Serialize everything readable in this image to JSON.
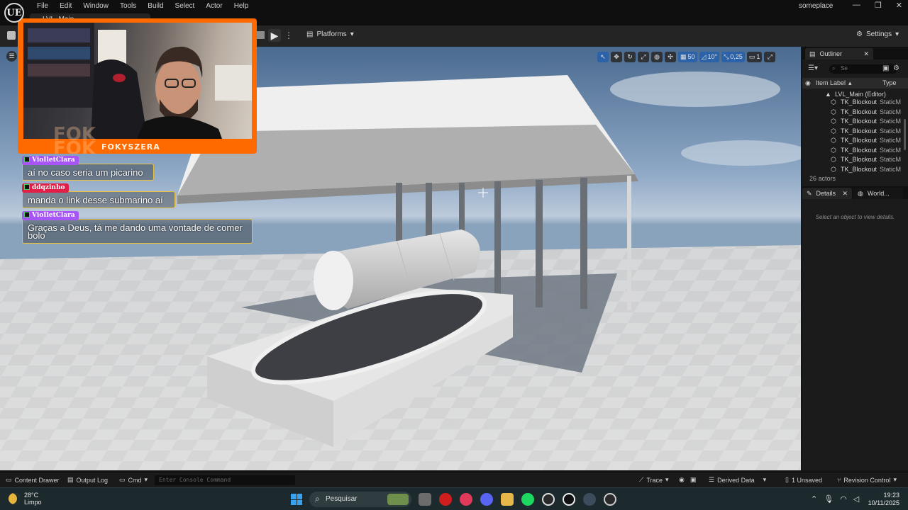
{
  "app": {
    "logo": "UE",
    "project_name": "someplace",
    "level_tab": "LVL_Main"
  },
  "menu": [
    "File",
    "Edit",
    "Window",
    "Tools",
    "Build",
    "Select",
    "Actor",
    "Help"
  ],
  "window_controls": {
    "minimize": "—",
    "restore": "❐",
    "close": "✕"
  },
  "toolbar": {
    "platforms_label": "Platforms",
    "settings_label": "Settings"
  },
  "viewport_toolbar": {
    "grid_snap": "50",
    "rotation_snap": "10°",
    "scale_snap": "0,25",
    "camera_speed": "1"
  },
  "stream": {
    "streamer_name": "FOKYSZERA",
    "overlay_bg_text": "FOK\nFOK",
    "accent_color": "#ff6a00",
    "chat": [
      {
        "user": "VioIletClara",
        "user_color": "#a855f7",
        "text": "aí no caso seria um picarino"
      },
      {
        "user": "ddqzinho",
        "user_color": "#e11d48",
        "text": "manda o link desse submarino aí"
      },
      {
        "user": "VioIletClara",
        "user_color": "#a855f7",
        "text": "Graças a Deus, tá me dando uma vontade de comer bolo"
      }
    ]
  },
  "outliner": {
    "tab_label": "Outliner",
    "search_placeholder": "Se",
    "col_label": "Item Label",
    "col_type": "Type",
    "root": "LVL_Main (Editor)",
    "rows": [
      {
        "label": "TK_Blockout",
        "type": "StaticM"
      },
      {
        "label": "TK_Blockout",
        "type": "StaticM"
      },
      {
        "label": "TK_Blockout",
        "type": "StaticM"
      },
      {
        "label": "TK_Blockout",
        "type": "StaticM"
      },
      {
        "label": "TK_Blockout",
        "type": "StaticM"
      },
      {
        "label": "TK_Blockout",
        "type": "StaticM"
      },
      {
        "label": "TK_Blockout",
        "type": "StaticM"
      },
      {
        "label": "TK_Blockout",
        "type": "StaticM"
      }
    ],
    "actor_count": "26 actors"
  },
  "details": {
    "tab_label": "Details",
    "world_tab_label": "World...",
    "empty_text": "Select an object to view details."
  },
  "bottombar": {
    "content_drawer": "Content Drawer",
    "output_log": "Output Log",
    "cmd": "Cmd",
    "console_placeholder": "Enter Console Command",
    "trace": "Trace",
    "derived_data": "Derived Data",
    "unsaved": "1 Unsaved",
    "revision_control": "Revision Control"
  },
  "taskbar": {
    "temperature": "28°C",
    "weather": "Limpo",
    "search_label": "Pesquisar",
    "time": "19:23",
    "date": "10/11/2025"
  }
}
